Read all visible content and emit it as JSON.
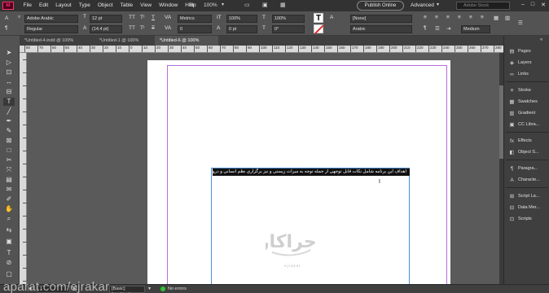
{
  "app": {
    "logo_text": "Id",
    "menu": [
      "File",
      "Edit",
      "Layout",
      "Type",
      "Object",
      "Table",
      "View",
      "Window",
      "Help"
    ],
    "zoom": "100%",
    "publish_label": "Publish Online",
    "workspace": "Advanced",
    "stock_placeholder": "Adobe Stock"
  },
  "control": {
    "font_family": "Adobe Arabic",
    "font_style": "Regular",
    "font_size": "12 pt",
    "leading": "(14.4 pt)",
    "kerning": "Metrics",
    "tracking": "0",
    "horiz_scale": "100%",
    "vert_scale": "100%",
    "baseline_shift": "0 pt",
    "skew": "0°",
    "char_style": "[None]",
    "language": "Arabic",
    "align_mode": "Medium",
    "T_label": "T",
    "TT_label": "TT",
    "Tt_label": "Tᵗ",
    "underline_label": "T",
    "strike_label": "T",
    "A_label": "A",
    "zero_field": "0"
  },
  "tabs": [
    {
      "label": "*Untitled-4.indd @ 100%"
    },
    {
      "label": "*Untitled-1 @ 100%"
    },
    {
      "label": "*Untitled-6 @ 100%"
    }
  ],
  "ruler": [
    "80",
    "70",
    "60",
    "50",
    "40",
    "30",
    "20",
    "10",
    "0",
    "10",
    "20",
    "30",
    "40",
    "50",
    "60",
    "70",
    "80",
    "90",
    "100",
    "110",
    "120",
    "130",
    "140",
    "150",
    "160",
    "170",
    "180",
    "190",
    "200",
    "210",
    "220",
    "230",
    "240",
    "250",
    "260",
    "270",
    "280"
  ],
  "document": {
    "selected_text": "اهداف این برنامه شامل نکات قابل توجهی از جمله توجه به میراث زیستی و نیز برگزاری نظم انسانی و دروس میشود",
    "watermark_logo": "اجراکار",
    "watermark_url": "ejrakar"
  },
  "panels": [
    {
      "label": "Pages",
      "icon": "▤"
    },
    {
      "label": "Layers",
      "icon": "◈"
    },
    {
      "label": "Links",
      "icon": "∞"
    },
    {
      "label": "Stroke",
      "icon": "≡"
    },
    {
      "label": "Swatches",
      "icon": "▦"
    },
    {
      "label": "Gradient",
      "icon": "▥"
    },
    {
      "label": "CC Libra...",
      "icon": "▣"
    },
    {
      "label": "Effects",
      "icon": "fx"
    },
    {
      "label": "Object S...",
      "icon": "◧"
    },
    {
      "label": "Paragra...",
      "icon": "¶"
    },
    {
      "label": "Characte...",
      "icon": "A"
    },
    {
      "label": "Script La...",
      "icon": "⊞"
    },
    {
      "label": "Data Mer...",
      "icon": "⊟"
    },
    {
      "label": "Scripts",
      "icon": "⊡"
    }
  ],
  "status": {
    "watermark_text": "aparat.com/ejrakar",
    "page": "1",
    "mode": "[Basic] (working)",
    "preflight": "No errors"
  },
  "colors": {
    "margin_guide": "#b46fd8",
    "frame": "#4a90d9",
    "preflight_ok": "#35c035"
  }
}
